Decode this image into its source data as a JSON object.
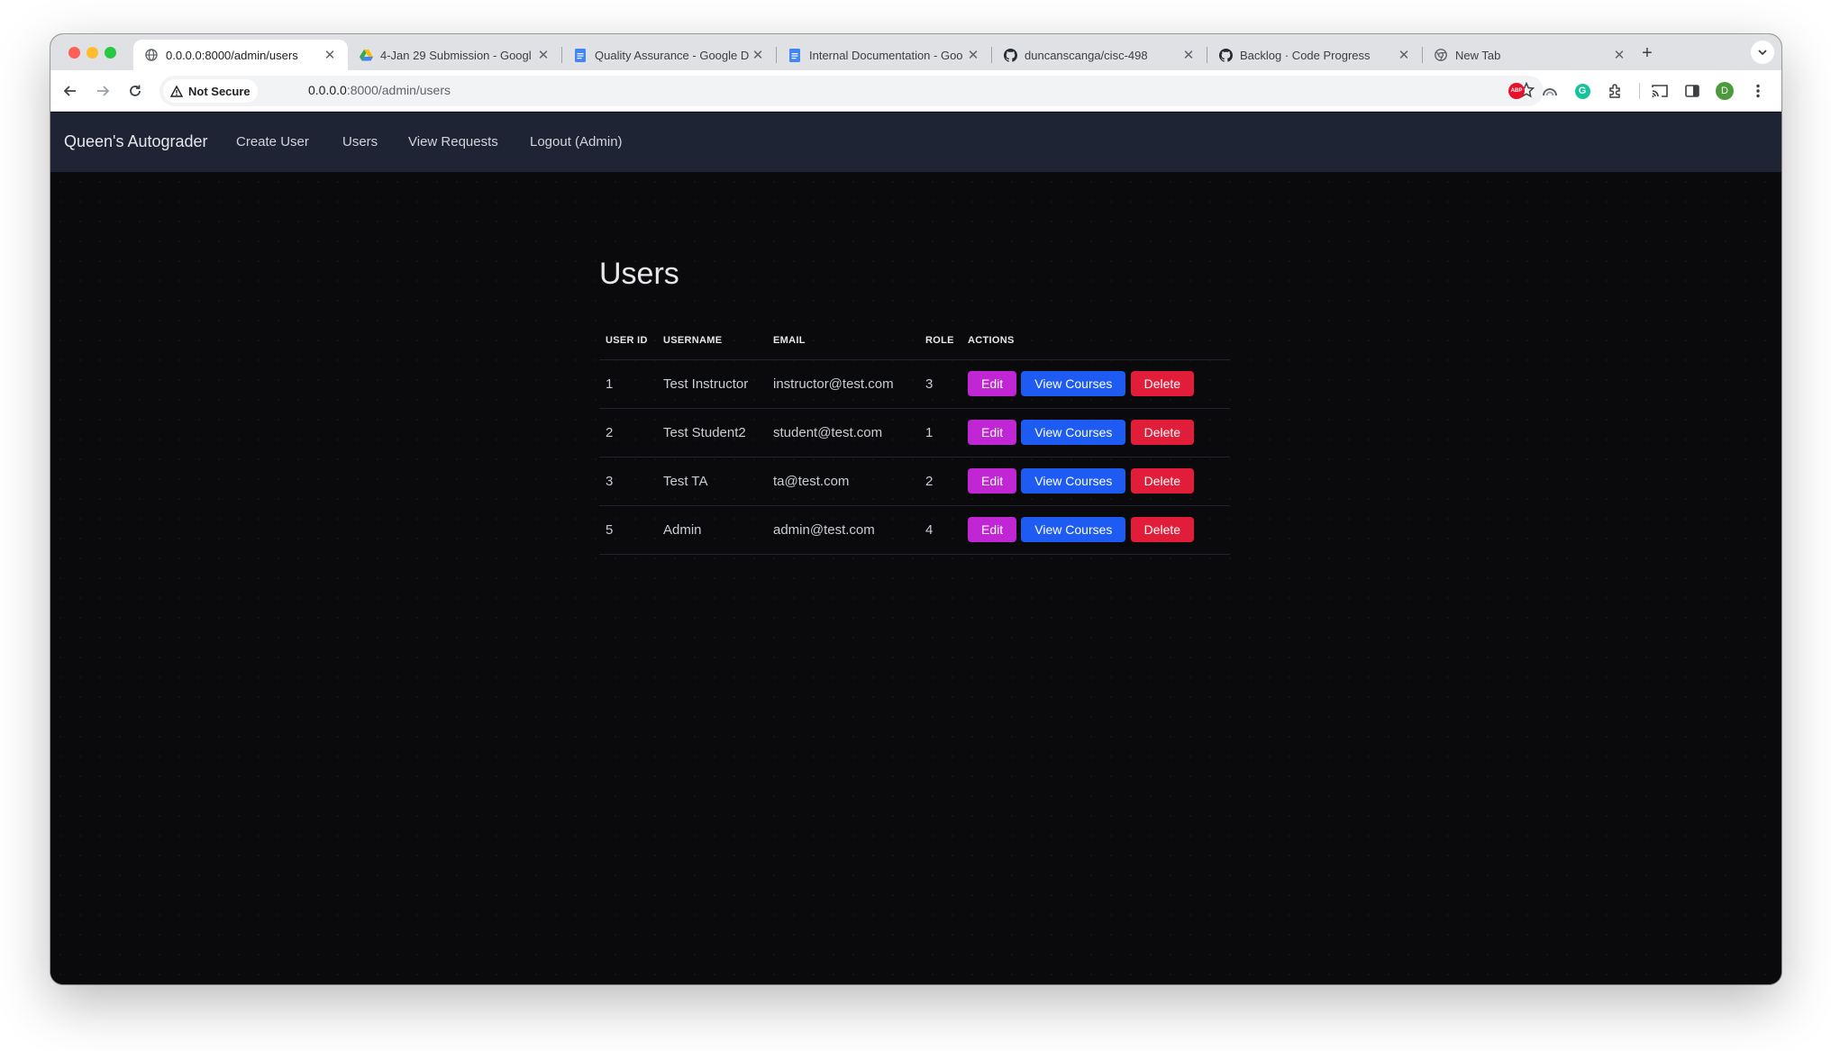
{
  "browser": {
    "tabs": [
      {
        "title": "0.0.0.0:8000/admin/users",
        "icon": "globe-icon",
        "active": true
      },
      {
        "title": "4-Jan 29 Submission - Googl",
        "icon": "drive-icon",
        "active": false
      },
      {
        "title": "Quality Assurance - Google D",
        "icon": "docs-icon",
        "active": false
      },
      {
        "title": "Internal Documentation - Goo",
        "icon": "docs-icon",
        "active": false
      },
      {
        "title": "duncanscanga/cisc-498",
        "icon": "github-icon",
        "active": false
      },
      {
        "title": "Backlog · Code Progress",
        "icon": "github-icon",
        "active": false
      },
      {
        "title": "New Tab",
        "icon": "chrome-icon",
        "active": false
      }
    ],
    "security_chip": "Not Secure",
    "url_host": "0.0.0.0",
    "url_path": ":8000/admin/users",
    "profile_initial": "D",
    "extensions": {
      "abp": "ABP",
      "grammarly": "G"
    }
  },
  "navbar": {
    "brand": "Queen's Autograder",
    "links": [
      "Create User",
      "Users",
      "View Requests",
      "Logout (Admin)"
    ]
  },
  "main": {
    "title": "Users",
    "table": {
      "headers": [
        "USER ID",
        "USERNAME",
        "EMAIL",
        "ROLE",
        "ACTIONS"
      ],
      "rows": [
        {
          "id": "1",
          "username": "Test Instructor",
          "email": "instructor@test.com",
          "role": "3"
        },
        {
          "id": "2",
          "username": "Test Student2",
          "email": "student@test.com",
          "role": "1"
        },
        {
          "id": "3",
          "username": "Test TA",
          "email": "ta@test.com",
          "role": "2"
        },
        {
          "id": "5",
          "username": "Admin",
          "email": "admin@test.com",
          "role": "4"
        }
      ],
      "actions": {
        "edit": "Edit",
        "view_courses": "View Courses",
        "delete": "Delete"
      }
    }
  },
  "colors": {
    "navbar_bg": "#1e2433",
    "page_bg": "#0a0a0c",
    "edit_button": "#c026d3",
    "view_button": "#1d5bf2",
    "delete_button": "#e11d3a"
  }
}
